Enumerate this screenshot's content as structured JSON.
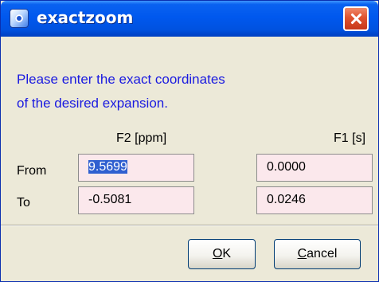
{
  "window": {
    "title": "exactzoom",
    "icon": "app-icon"
  },
  "instructions": {
    "line1": "Please enter the exact coordinates",
    "line2": "of the desired expansion."
  },
  "columns": {
    "f2": "F2 [ppm]",
    "f1": "F1 [s]"
  },
  "rows": {
    "from": "From",
    "to": "To"
  },
  "values": {
    "from_f2": "9.5699",
    "to_f2": "-0.5081",
    "from_f1": "0.0000",
    "to_f1": "0.0246"
  },
  "buttons": {
    "ok_mnemonic": "O",
    "ok_rest": "K",
    "cancel_mnemonic": "C",
    "cancel_rest": "ancel"
  },
  "colors": {
    "title_bar": "#0058ee",
    "instruction_text": "#1a1ae0",
    "field_background": "#fbe8ec",
    "close_button": "#e0522e"
  }
}
